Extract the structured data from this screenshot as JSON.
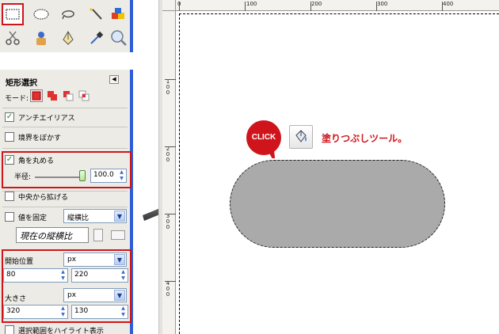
{
  "toolbox": {
    "tools": [
      {
        "name": "rect-select-icon"
      },
      {
        "name": "ellipse-select-icon"
      },
      {
        "name": "lasso-icon"
      },
      {
        "name": "magic-wand-icon"
      },
      {
        "name": "color-select-icon"
      },
      {
        "name": "scissors-icon"
      },
      {
        "name": "foreground-select-icon"
      },
      {
        "name": "paths-icon"
      },
      {
        "name": "color-picker-icon"
      },
      {
        "name": "zoom-icon"
      }
    ]
  },
  "options": {
    "title": "矩形選択",
    "mode_label": "モード:",
    "antialias_label": "アンチエイリアス",
    "antialias_checked": true,
    "feather_label": "境界をぼかす",
    "feather_checked": false,
    "round_corners_label": "角を丸める",
    "round_corners_checked": true,
    "radius_label": "半径:",
    "radius_value": "100.0",
    "expand_center_label": "中央から拡げる",
    "expand_center_checked": false,
    "fixed_label": "値を固定",
    "fixed_checked": false,
    "fixed_combo": "縦横比",
    "aspect_placeholder": "現在の縦横比",
    "position_label": "開始位置",
    "position_unit": "px",
    "position_x": "80",
    "position_y": "220",
    "size_label": "大きさ",
    "size_unit": "px",
    "size_w": "320",
    "size_h": "130",
    "highlight_label": "選択範囲をハイライト表示",
    "check_mark": "✓"
  },
  "ruler": {
    "top_labels": [
      "0",
      "100",
      "200",
      "300",
      "400"
    ],
    "left_labels": [
      "1\n0\n0",
      "2\n0\n0",
      "3\n0\n0",
      "4\n0\n0"
    ]
  },
  "annotation": {
    "click_text": "CLICK",
    "bucket_label": "塗りつぶしツール。"
  },
  "colors": {
    "highlight_red": "#d0141c",
    "panel_bg": "#edebe6",
    "panel_edge_blue": "#2d5ed8",
    "selection_fill": "#aaaaaa"
  }
}
